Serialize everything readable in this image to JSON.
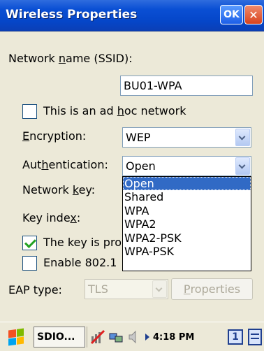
{
  "window": {
    "title": "Wireless Properties",
    "ok_label": "OK",
    "close_label": "✕"
  },
  "form": {
    "network_name_label_pre": "Network ",
    "network_name_label_key": "n",
    "network_name_label_post": "ame (SSID):",
    "ssid_value": "BU01-WPA",
    "adhoc_label_pre": "This is an ad ",
    "adhoc_label_key": "h",
    "adhoc_label_post": "oc network",
    "adhoc_checked": false,
    "encryption_label_key": "E",
    "encryption_label_post": "ncryption:",
    "encryption_value": "WEP",
    "authentication_label_pre": "Aut",
    "authentication_label_key": "h",
    "authentication_label_post": "entication:",
    "authentication_value": "Open",
    "network_key_label_pre": "Network ",
    "network_key_label_key": "k",
    "network_key_label_post": "ey:",
    "key_index_label_pre": "Key inde",
    "key_index_label_key": "x",
    "key_index_label_post": ":",
    "key_auto_label": "The key is pro",
    "key_auto_checked": true,
    "enable_8021x_label": "Enable 802.1",
    "enable_8021x_checked": false,
    "eap_label": "EAP type:",
    "eap_value": "TLS",
    "properties_key": "P",
    "properties_post": "roperties"
  },
  "auth_options": [
    "Open",
    "Shared",
    "WPA",
    "WPA2",
    "WPA2-PSK",
    "WPA-PSK"
  ],
  "auth_selected_index": 0,
  "taskbar": {
    "app_label": "SDIO...",
    "clock": "4:18 PM",
    "input_badge": "1"
  },
  "colors": {
    "titlebar": "#0546c8",
    "selection": "#316ac5",
    "check": "#21a121"
  }
}
